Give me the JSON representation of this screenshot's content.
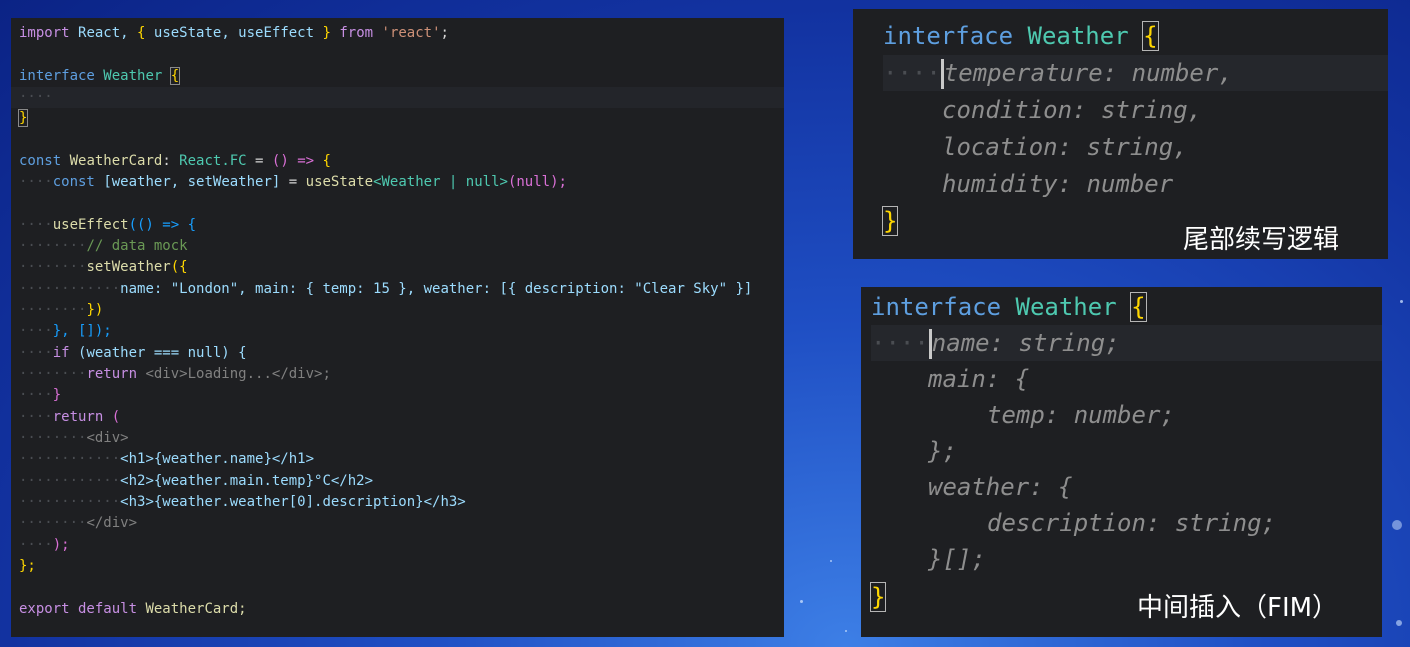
{
  "main_editor": {
    "lines": {
      "import_kw": "import",
      "import_react": "React,",
      "import_lb": "{",
      "import_names": " useState, useEffect ",
      "import_rb": "}",
      "import_from": "from",
      "import_mod": "'react'",
      "import_semi": ";",
      "iface_kw": "interface",
      "iface_name": "Weather",
      "iface_lb": "{",
      "iface_ws": "····",
      "iface_rb": "}",
      "const_kw": "const",
      "comp_name": "WeatherCard",
      "comp_type": "React.FC",
      "comp_eq": "=",
      "comp_arrow": "() =>",
      "comp_lb": "{",
      "state_ws": "····",
      "state_const": "const",
      "state_destr": "[weather, setWeather]",
      "state_eq": "=",
      "state_fn": "useState",
      "state_generic": "<Weather | null>",
      "state_init": "(null);",
      "effect_ws": "····",
      "effect_fn": "useEffect",
      "effect_args": "(() => {",
      "mock_ws": "········",
      "mock_comment": "// data mock",
      "set_ws": "········",
      "set_fn": "setWeather",
      "set_open": "({",
      "obj_ws": "············",
      "obj_body": "name: \"London\", main: { temp: 15 }, weather: [{ description: \"Clear Sky\" }]",
      "set_close_ws": "········",
      "set_close": "})",
      "effect_close_ws": "····",
      "effect_close": "}, []);",
      "if_ws": "····",
      "if_kw": "if",
      "if_cond": "(weather === null) {",
      "ret1_ws": "········",
      "ret1_kw": "return",
      "ret1_jsx": "<div>Loading...</div>;",
      "if_close_ws": "····",
      "if_close": "}",
      "ret_ws": "····",
      "ret_kw": "return",
      "ret_paren": "(",
      "div_ws": "········",
      "div_open": "<div>",
      "h1_ws": "············",
      "h1_line": "<h1>{weather.name}</h1>",
      "h2_ws": "············",
      "h2_line": "<h2>{weather.main.temp}°C</h2>",
      "h3_ws": "············",
      "h3_line": "<h3>{weather.weather[0].description}</h3>",
      "div_close_ws": "········",
      "div_close": "</div>",
      "paren_close_ws": "····",
      "paren_close": ");",
      "comp_close": "};",
      "export_kw": "export default",
      "export_name": "WeatherCard;"
    }
  },
  "panel_top": {
    "iface_kw": "interface",
    "iface_name": "Weather",
    "iface_lb": "{",
    "ws": "····",
    "l1": "temperature: number,",
    "l2": "condition: string,",
    "l3": "location: string,",
    "l4": "humidity: number",
    "iface_rb": "}",
    "caption": "尾部续写逻辑"
  },
  "panel_bottom": {
    "iface_kw": "interface",
    "iface_name": "Weather",
    "iface_lb": "{",
    "ws": "····",
    "l1": "name: string;",
    "l2": "main: {",
    "l3": "temp: number;",
    "l4": "};",
    "l5": "weather: {",
    "l6": "description: string;",
    "l7": "}[];",
    "iface_rb": "}",
    "caption": "中间插入（FIM）"
  },
  "colors": {
    "background": "#1f4fc4",
    "editor_bg": "#1e1f22",
    "keyword": "#c78fe3",
    "type": "#4ec9b0",
    "bracket": "#ffd700"
  }
}
